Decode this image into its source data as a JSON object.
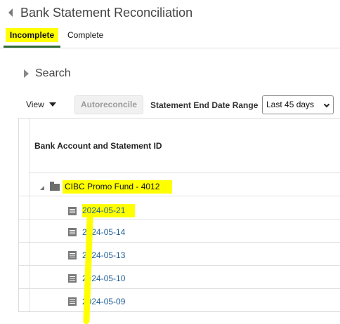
{
  "page": {
    "title": "Bank Statement Reconciliation"
  },
  "tabs": [
    {
      "label": "Incomplete",
      "selected": true
    },
    {
      "label": "Complete",
      "selected": false
    }
  ],
  "search": {
    "label": "Search"
  },
  "toolbar": {
    "view_label": "View",
    "autoreconcile_label": "Autoreconcile",
    "date_range_label": "Statement End Date Range",
    "date_range_value": "Last 45 days"
  },
  "table": {
    "header": "Bank Account and Statement ID",
    "account": {
      "label": "CIBC Promo Fund - 4012",
      "expanded": true
    },
    "statements": [
      {
        "id": "2024-05-21"
      },
      {
        "id": "2024-05-14"
      },
      {
        "id": "2024-05-13"
      },
      {
        "id": "2024-05-10"
      },
      {
        "id": "2024-05-09"
      }
    ]
  },
  "colors": {
    "highlight": "#ffff00",
    "tab_underline": "#2f6b35",
    "link": "#1f5e97"
  }
}
